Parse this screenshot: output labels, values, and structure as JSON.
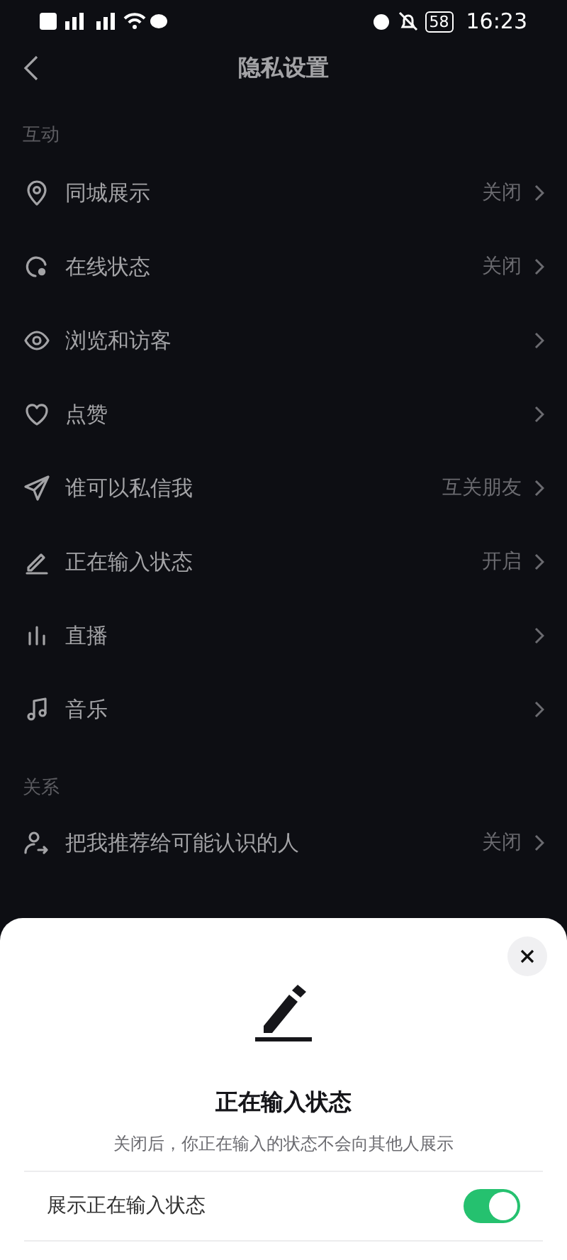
{
  "status_bar": {
    "time": "16:23",
    "battery": "58"
  },
  "header": {
    "title": "隐私设置"
  },
  "sections": [
    {
      "title": "互动",
      "items": [
        {
          "label": "同城展示",
          "value": "关闭"
        },
        {
          "label": "在线状态",
          "value": "关闭"
        },
        {
          "label": "浏览和访客"
        },
        {
          "label": "点赞"
        },
        {
          "label": "谁可以私信我",
          "value": "互关朋友"
        },
        {
          "label": "正在输入状态",
          "value": "开启"
        },
        {
          "label": "直播"
        },
        {
          "label": "音乐"
        }
      ]
    },
    {
      "title": "关系",
      "items": [
        {
          "label": "把我推荐给可能认识的人",
          "value": "关闭"
        }
      ]
    }
  ],
  "sheet": {
    "title": "正在输入状态",
    "description": "关闭后，你正在输入的状态不会向其他人展示",
    "toggle": {
      "label": "展示正在输入状态",
      "on": true
    }
  }
}
